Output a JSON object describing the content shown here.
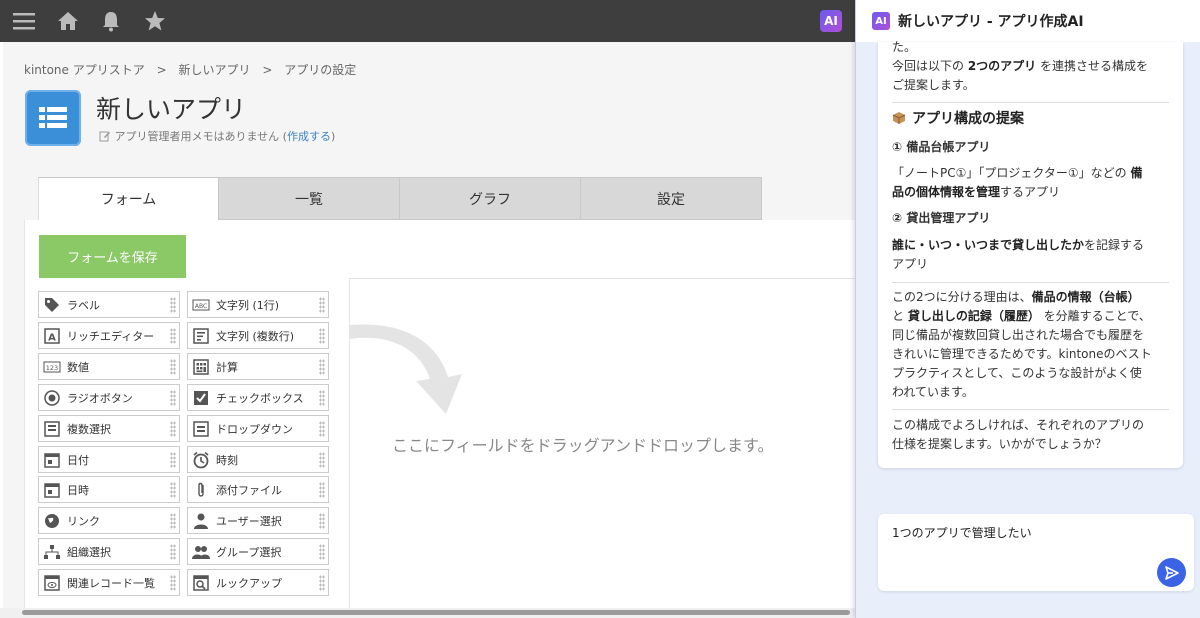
{
  "topbar": {
    "icons": [
      "menu-icon",
      "home-icon",
      "bell-icon",
      "star-icon"
    ],
    "ai_badge": "AI"
  },
  "breadcrumb": [
    "kintone アプリストア",
    ">",
    "新しいアプリ",
    ">",
    "アプリの設定"
  ],
  "app": {
    "title": "新しいアプリ",
    "memo": "アプリ管理者用メモはありません",
    "memo_link_open": "(",
    "memo_link": "作成する",
    "memo_link_close": ")"
  },
  "tabs": [
    "フォーム",
    "一覧",
    "グラフ",
    "設定"
  ],
  "form": {
    "save_label": "フォームを保存",
    "drop_text": "ここにフィールドをドラッグアンドドロップします。",
    "palette_left": [
      "ラベル",
      "リッチエディター",
      "数値",
      "ラジオボタン",
      "複数選択",
      "日付",
      "日時",
      "リンク",
      "組織選択",
      "関連レコード一覧"
    ],
    "palette_right": [
      "文字列 (1行)",
      "文字列 (複数行)",
      "計算",
      "チェックボックス",
      "ドロップダウン",
      "時刻",
      "添付ファイル",
      "ユーザー選択",
      "グループ選択",
      "ルックアップ"
    ],
    "icons_left": [
      "tag-icon",
      "rich-editor-icon",
      "number-icon",
      "radio-icon",
      "multi-select-icon",
      "date-icon",
      "datetime-icon",
      "globe-icon",
      "org-icon",
      "related-records-icon"
    ],
    "icons_right": [
      "text-line-icon",
      "text-area-icon",
      "calculator-icon",
      "checkbox-icon",
      "dropdown-icon",
      "clock-icon",
      "paperclip-icon",
      "user-icon",
      "group-icon",
      "lookup-icon"
    ]
  },
  "ai": {
    "badge": "AI",
    "title": "新しいアプリ - アプリ作成AI",
    "m_top": "た。",
    "m_intro1a": "今回は以下の ",
    "m_intro1b": "2つのアプリ",
    "m_intro1c": " を連携させる構成を",
    "m_intro2": "ご提案します。",
    "m_heading": "アプリ構成の提案",
    "m_app1": "① 備品台帳アプリ",
    "m_app1_d1a": "「ノートPC①」「プロジェクター①」などの ",
    "m_app1_d1b": "備",
    "m_app1_d2a": "品の個体情報を管理",
    "m_app1_d2b": "するアプリ",
    "m_app2": "② 貸出管理アプリ",
    "m_app2_d1a": "誰に・いつ・いつまで貸し出したか",
    "m_app2_d1b": "を記録する",
    "m_app2_d2": "アプリ",
    "m_reason1a": "この2つに分ける理由は、",
    "m_reason1b": "備品の情報（台帳）",
    "m_reason2a": "と ",
    "m_reason2b": "貸し出しの記録（履歴）",
    "m_reason2c": " を分離することで、",
    "m_reason3": "同じ備品が複数回貸し出された場合でも履歴を",
    "m_reason4": "きれいに管理できるためです。kintoneのベスト",
    "m_reason5": "プラクティスとして、このような設計がよく使",
    "m_reason6": "われています。",
    "m_ask1": "この構成でよろしければ、それぞれのアプリの",
    "m_ask2": "仕様を提案します。いかがでしょうか？",
    "input_value": "1つのアプリで管理したい"
  }
}
